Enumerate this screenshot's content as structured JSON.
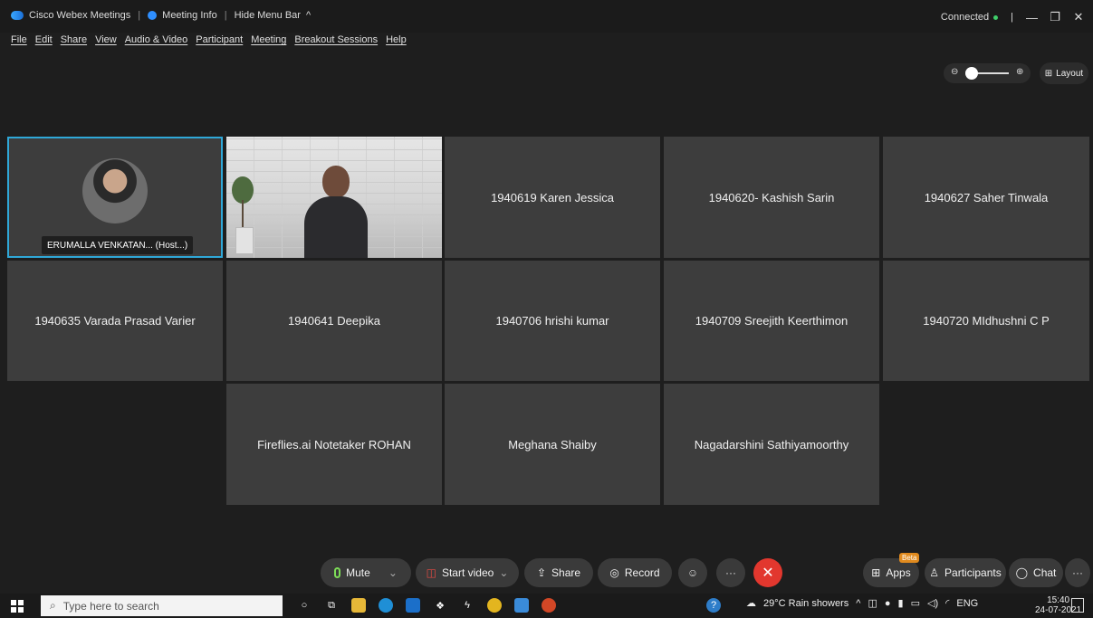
{
  "titlebar": {
    "app": "Cisco Webex Meetings",
    "meeting_info": "Meeting Info",
    "hide_menu": "Hide Menu Bar",
    "status": "Connected"
  },
  "menu": [
    "File",
    "Edit",
    "Share",
    "View",
    "Audio & Video",
    "Participant",
    "Meeting",
    "Breakout Sessions",
    "Help"
  ],
  "layout_label": "Layout",
  "host_tile": {
    "name": "ERUMALLA VENKATAN... (Host...)"
  },
  "tiles": [
    "1940619 Karen Jessica",
    "1940620- Kashish Sarin",
    "1940627 Saher Tinwala",
    "1940635 Varada Prasad Varier",
    "1940641 Deepika",
    "1940706 hrishi kumar",
    "1940709 Sreejith Keerthimon",
    "1940720 MIdhushni C P",
    "Fireflies.ai Notetaker ROHAN",
    "Meghana Shaiby",
    "Nagadarshini Sathiyamoorthy"
  ],
  "controls": {
    "mute": "Mute",
    "start_video": "Start video",
    "share": "Share",
    "record": "Record",
    "apps": "Apps",
    "apps_badge": "Beta",
    "participants": "Participants",
    "chat": "Chat"
  },
  "taskbar": {
    "search_placeholder": "Type here to search",
    "weather": "29°C  Rain showers",
    "language": "ENG",
    "time": "15:40",
    "date": "24-07-2021"
  }
}
